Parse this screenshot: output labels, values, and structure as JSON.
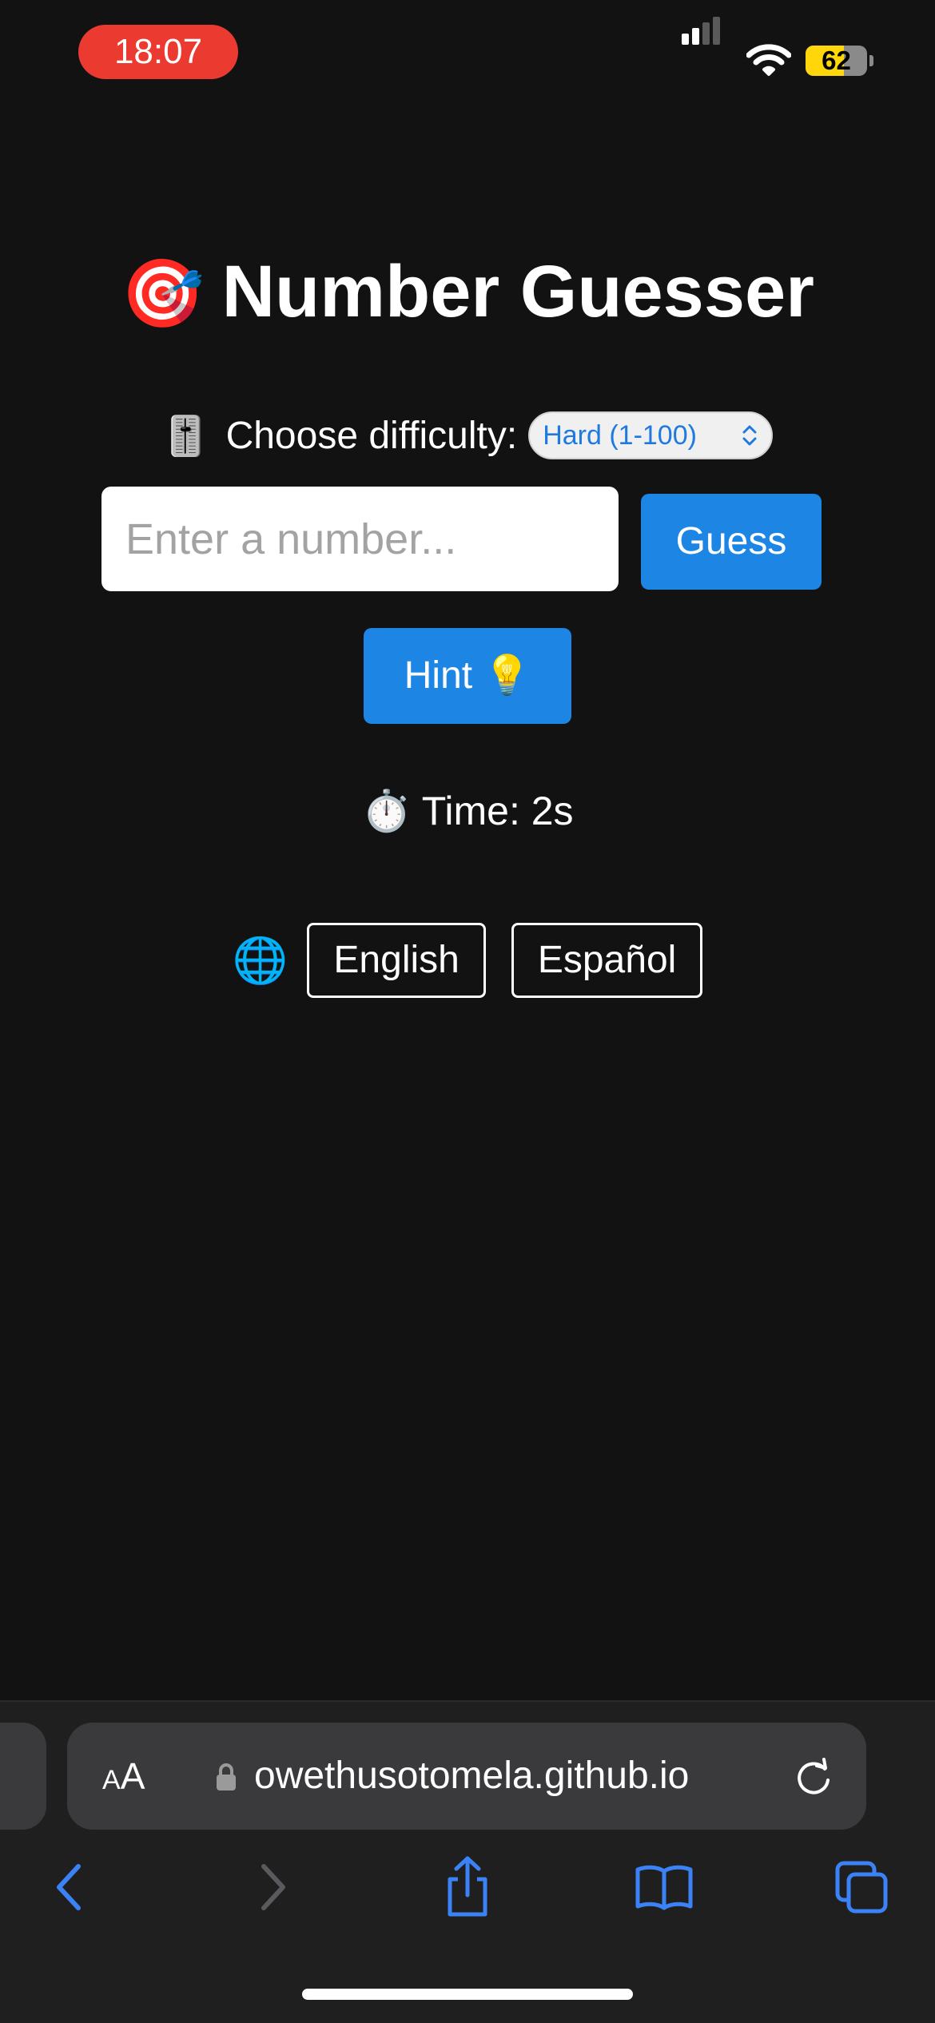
{
  "status_bar": {
    "time": "18:07",
    "battery": "62",
    "battery_level": 0.62,
    "colors": {
      "time_pill": "#eb3b31",
      "battery_fill": "#ffd60a"
    },
    "icons": [
      "signal-icon",
      "wifi-icon",
      "battery-icon"
    ]
  },
  "app": {
    "title_emoji": "🎯",
    "title": "Number Guesser",
    "difficulty": {
      "emoji": "🎚️",
      "label": "Choose difficulty:",
      "selected": "Hard (1-100)"
    },
    "input": {
      "placeholder": "Enter a number...",
      "value": ""
    },
    "guess_label": "Guess",
    "hint_label": "Hint 💡",
    "timer": "⏱️ Time: 2s",
    "language": {
      "globe_emoji": "🌐",
      "options": [
        "English",
        "Español"
      ]
    },
    "colors": {
      "accent": "#1d85e3",
      "background": "#121212"
    }
  },
  "browser": {
    "text_size_label_small": "A",
    "text_size_label_large": "A",
    "url": "owethusotomela.github.io",
    "icons": [
      "lock-icon",
      "reload-icon",
      "back-icon",
      "forward-icon",
      "share-icon",
      "bookmarks-icon",
      "tabs-icon"
    ],
    "colors": {
      "toolbar_accent": "#3b82f6"
    }
  }
}
